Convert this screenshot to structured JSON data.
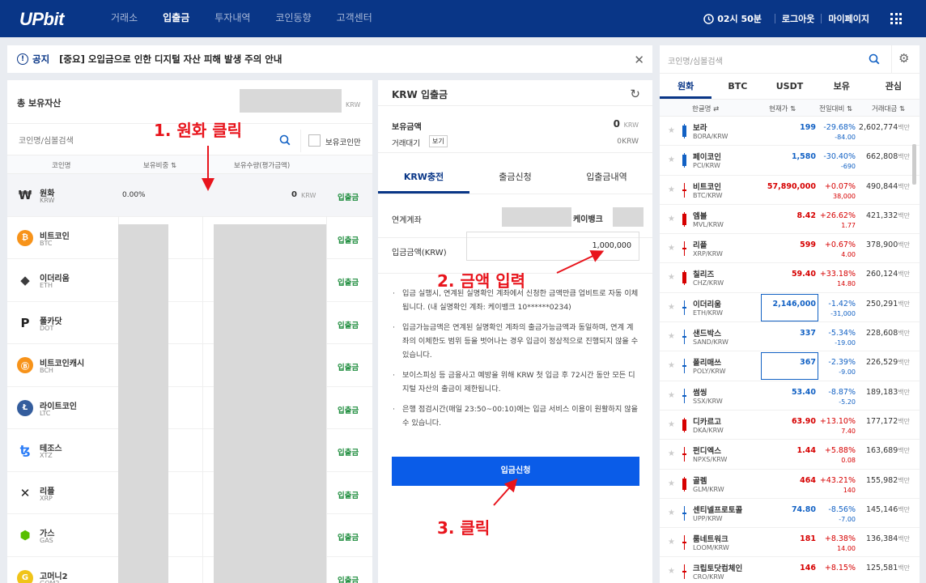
{
  "header": {
    "logo": "UPbit",
    "nav": [
      "거래소",
      "입출금",
      "투자내역",
      "코인동향",
      "고객센터"
    ],
    "active_nav": 1,
    "clock": "02시 50분",
    "logout": "로그아웃",
    "mypage": "마이페이지"
  },
  "notice": {
    "icon": "!",
    "label": "공지",
    "message": "[중요] 오입금으로 인한 디지털 자산 피해 발생 주의 안내"
  },
  "assets": {
    "total_label": "총 보유자산",
    "total_unit": "KRW",
    "search_placeholder": "코인명/심볼검색",
    "only_owned": "보유코인만",
    "columns": [
      "코인명",
      "보유비중 ⇅",
      "보유수량(평가금액)"
    ],
    "rows": [
      {
        "name": "원화",
        "symbol": "KRW",
        "ratio": "0.00%",
        "qty": "0",
        "qty_unit": "KRW",
        "action": "입출금",
        "icon": "won-sign",
        "color": "#333333"
      },
      {
        "name": "비트코인",
        "symbol": "BTC",
        "action": "입출금",
        "icon": "bitcoin-icon",
        "color": "#f7931a"
      },
      {
        "name": "이더리움",
        "symbol": "ETH",
        "action": "입출금",
        "icon": "ethereum-icon",
        "color": "#3c3c3d"
      },
      {
        "name": "폴카닷",
        "symbol": "DOT",
        "action": "입출금",
        "icon": "polkadot-icon",
        "color": "#222222"
      },
      {
        "name": "비트코인캐시",
        "symbol": "BCH",
        "action": "입출금",
        "icon": "bitcoin-cash-icon",
        "color": "#f7931a"
      },
      {
        "name": "라이트코인",
        "symbol": "LTC",
        "action": "입출금",
        "icon": "litecoin-icon",
        "color": "#345d9d"
      },
      {
        "name": "테조스",
        "symbol": "XTZ",
        "action": "입출금",
        "icon": "tezos-icon",
        "color": "#2c7df7"
      },
      {
        "name": "리플",
        "symbol": "XRP",
        "action": "입출금",
        "icon": "ripple-icon",
        "color": "#222222"
      },
      {
        "name": "가스",
        "symbol": "GAS",
        "action": "입출금",
        "icon": "gas-icon",
        "color": "#58bf00"
      },
      {
        "name": "고머니2",
        "symbol": "GOM2",
        "action": "입출금",
        "icon": "gomoney-icon",
        "color": "#f0c419"
      }
    ]
  },
  "krw": {
    "title": "KRW 입출금",
    "balance_label": "보유금액",
    "balance_value": "0",
    "balance_unit": "KRW",
    "pending_label": "거래대기",
    "pending_btn": "보기",
    "pending_value": "0",
    "pending_unit": "KRW",
    "tabs": [
      "KRW충전",
      "출금신청",
      "입출금내역"
    ],
    "linked_label": "연계계좌",
    "bank": "케이뱅크",
    "amount_label": "입금금액(KRW)",
    "amount_value": "1,000,000",
    "notes": [
      "입금 실행시, 연계된 실명확인 계좌에서 신청한 금액만큼 업비트로 자동 이체됩니다. (내 실명확인 계좌: 케이뱅크 10******0234)",
      "입금가능금액은 연계된 실명확인 계좌의 출금가능금액과 동일하며, 연계 계좌의 이체한도 범위 등을 벗어나는 경우 입금이 정상적으로 진행되지 않을 수 있습니다.",
      "보이스피싱 등 금융사고 예방을 위해 KRW 첫 입금 후 72시간 동안 모든 디지털 자산의 출금이 제한됩니다.",
      "은행 점검시간(매일 23:50~00:10)에는 입금 서비스 이용이 원활하지 않을 수 있습니다."
    ],
    "submit": "입금신청"
  },
  "market": {
    "search_placeholder": "코인명/심볼검색",
    "tabs": [
      "원화",
      "BTC",
      "USDT",
      "보유",
      "관심"
    ],
    "columns": [
      "한글명 ⇄",
      "현재가 ⇅",
      "전일대비 ⇅",
      "거래대금 ⇅"
    ],
    "rows": [
      {
        "name": "보라",
        "pair": "BORA/KRW",
        "price": "199",
        "pct": "-29.68%",
        "chg": "-84.00",
        "vol": "2,602,774",
        "dir": "dn"
      },
      {
        "name": "페이코인",
        "pair": "PCI/KRW",
        "price": "1,580",
        "pct": "-30.40%",
        "chg": "-690",
        "vol": "662,808",
        "dir": "dn"
      },
      {
        "name": "비트코인",
        "pair": "BTC/KRW",
        "price": "57,890,000",
        "pct": "+0.07%",
        "chg": "38,000",
        "vol": "490,844",
        "dir": "up"
      },
      {
        "name": "엠블",
        "pair": "MVL/KRW",
        "price": "8.42",
        "pct": "+26.62%",
        "chg": "1.77",
        "vol": "421,332",
        "dir": "up"
      },
      {
        "name": "리플",
        "pair": "XRP/KRW",
        "price": "599",
        "pct": "+0.67%",
        "chg": "4.00",
        "vol": "378,900",
        "dir": "up"
      },
      {
        "name": "칠리즈",
        "pair": "CHZ/KRW",
        "price": "59.40",
        "pct": "+33.18%",
        "chg": "14.80",
        "vol": "260,124",
        "dir": "up"
      },
      {
        "name": "이더리움",
        "pair": "ETH/KRW",
        "price": "2,146,000",
        "pct": "-1.42%",
        "chg": "-31,000",
        "vol": "250,291",
        "dir": "dn",
        "boxed": true
      },
      {
        "name": "샌드박스",
        "pair": "SAND/KRW",
        "price": "337",
        "pct": "-5.34%",
        "chg": "-19.00",
        "vol": "228,608",
        "dir": "dn"
      },
      {
        "name": "폴리매쓰",
        "pair": "POLY/KRW",
        "price": "367",
        "pct": "-2.39%",
        "chg": "-9.00",
        "vol": "226,529",
        "dir": "dn",
        "boxed": true
      },
      {
        "name": "썸씽",
        "pair": "SSX/KRW",
        "price": "53.40",
        "pct": "-8.87%",
        "chg": "-5.20",
        "vol": "189,183",
        "dir": "dn"
      },
      {
        "name": "디카르고",
        "pair": "DKA/KRW",
        "price": "63.90",
        "pct": "+13.10%",
        "chg": "7.40",
        "vol": "177,172",
        "dir": "up"
      },
      {
        "name": "펀디엑스",
        "pair": "NPXS/KRW",
        "price": "1.44",
        "pct": "+5.88%",
        "chg": "0.08",
        "vol": "163,689",
        "dir": "up"
      },
      {
        "name": "골렘",
        "pair": "GLM/KRW",
        "price": "464",
        "pct": "+43.21%",
        "chg": "140",
        "vol": "155,982",
        "dir": "up"
      },
      {
        "name": "센티넬프로토콜",
        "pair": "UPP/KRW",
        "price": "74.80",
        "pct": "-8.56%",
        "chg": "-7.00",
        "vol": "145,146",
        "dir": "dn"
      },
      {
        "name": "룸네트워크",
        "pair": "LOOM/KRW",
        "price": "181",
        "pct": "+8.38%",
        "chg": "14.00",
        "vol": "136,384",
        "dir": "up"
      },
      {
        "name": "크립토닷컴체인",
        "pair": "CRO/KRW",
        "price": "146",
        "pct": "+8.15%",
        "chg": "",
        "vol": "125,581",
        "dir": "up"
      }
    ],
    "vol_unit": "백만"
  },
  "annotations": [
    "1. 원화 클릭",
    "2. 금액 입력",
    "3. 클릭"
  ],
  "colors": {
    "brand": "#093687",
    "up": "#d60000",
    "down": "#1261c4",
    "action": "#1f8d3e",
    "annotation": "#e8141c",
    "button": "#0a5ce8"
  }
}
